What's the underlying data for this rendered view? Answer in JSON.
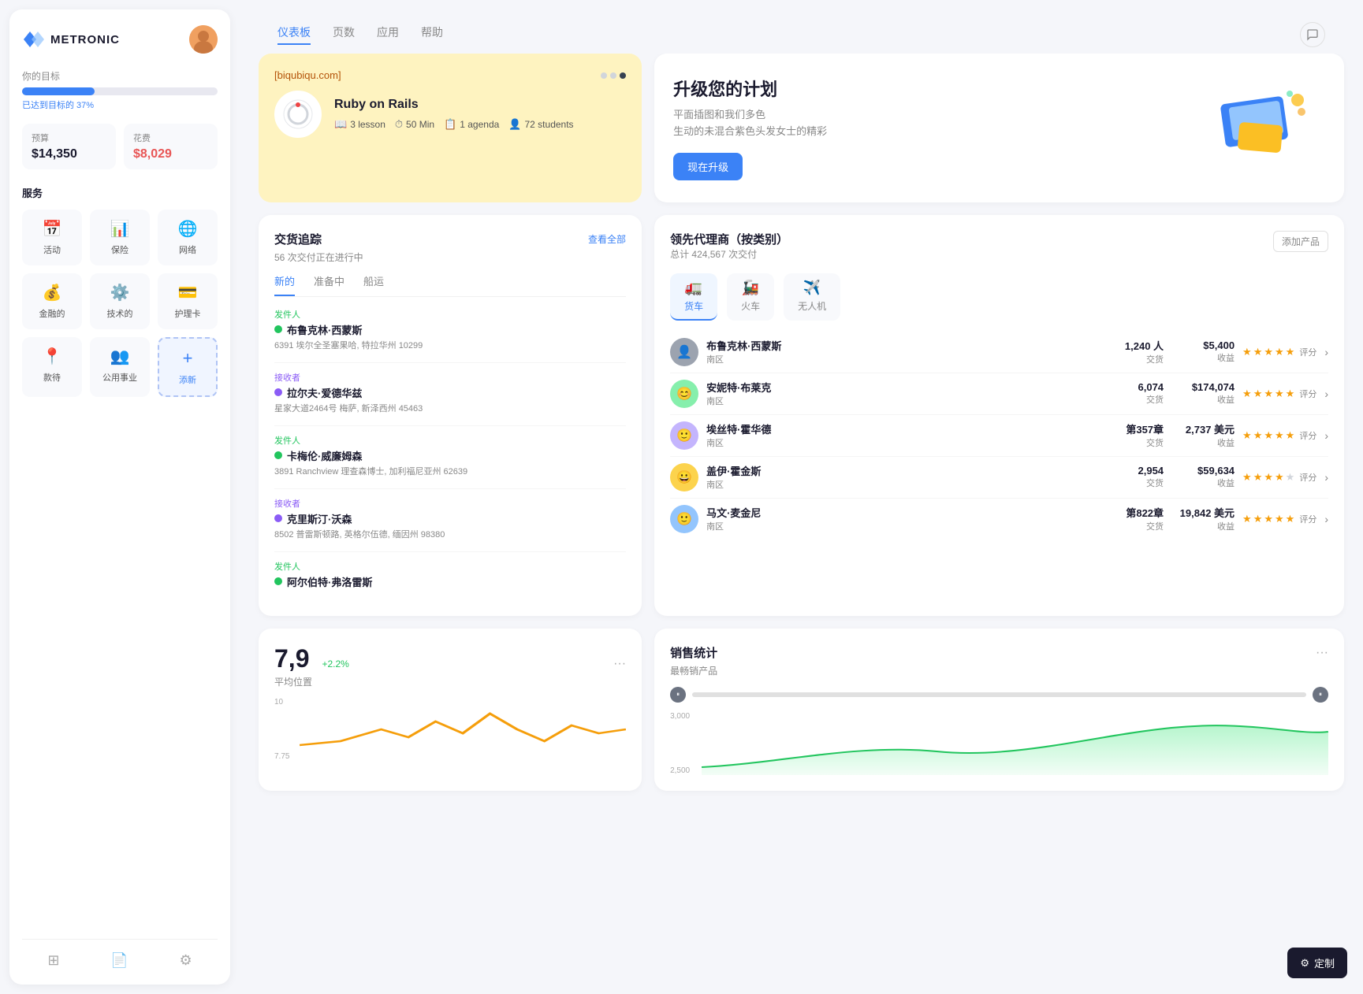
{
  "app": {
    "name": "METRONIC"
  },
  "nav": {
    "tabs": [
      "仪表板",
      "页数",
      "应用",
      "帮助"
    ],
    "active": "仪表板"
  },
  "sidebar": {
    "goal_label": "你的目标",
    "progress_percent": 37,
    "progress_text": "已达到目标的 37%",
    "budget": {
      "label": "预算",
      "value": "$14,350"
    },
    "expense": {
      "label": "花费",
      "value": "$8,029"
    },
    "services_label": "服务",
    "services": [
      {
        "icon": "📅",
        "label": "活动"
      },
      {
        "icon": "📊",
        "label": "保险"
      },
      {
        "icon": "🌐",
        "label": "网络"
      },
      {
        "icon": "💰",
        "label": "金融的"
      },
      {
        "icon": "⚙️",
        "label": "技术的"
      },
      {
        "icon": "💳",
        "label": "护理卡"
      },
      {
        "icon": "📍",
        "label": "款待"
      },
      {
        "icon": "👥",
        "label": "公用事业"
      },
      {
        "icon": "+",
        "label": "添新"
      }
    ],
    "footer_icons": [
      "layers",
      "file",
      "settings"
    ]
  },
  "course_card": {
    "url": "[biqubiqu.com]",
    "title": "Ruby on Rails",
    "meta": [
      {
        "icon": "📖",
        "text": "3 lesson"
      },
      {
        "icon": "⏱",
        "text": "50 Min"
      },
      {
        "icon": "📋",
        "text": "1 agenda"
      },
      {
        "icon": "👤",
        "text": "72 students"
      }
    ]
  },
  "upgrade_card": {
    "title": "升级您的计划",
    "description": "平面插图和我们多色\n生动的未混合紫色头发女士的精彩",
    "button_label": "现在升级"
  },
  "delivery": {
    "title": "交货追踪",
    "subtitle": "56 次交付正在进行中",
    "view_all": "查看全部",
    "tabs": [
      "新的",
      "准备中",
      "船运"
    ],
    "active_tab": "新的",
    "items": [
      {
        "role": "发件人",
        "role_type": "sender",
        "name": "布鲁克林·西蒙斯",
        "address": "6391 埃尔全圣塞果哈, 特拉华州 10299"
      },
      {
        "role": "接收者",
        "role_type": "receiver",
        "name": "拉尔夫·爱德华兹",
        "address": "星家大道2464号 梅萨, 新泽西州 45463"
      },
      {
        "role": "发件人",
        "role_type": "sender",
        "name": "卡梅伦·威廉姆森",
        "address": "3891 Ranchview 理查森博士, 加利福尼亚州 62639"
      },
      {
        "role": "接收者",
        "role_type": "receiver",
        "name": "克里斯汀·沃森",
        "address": "8502 普雷斯顿路, 英格尔伍德, 缅因州 98380"
      },
      {
        "role": "发件人",
        "role_type": "sender",
        "name": "阿尔伯特·弗洛雷斯",
        "address": ""
      }
    ]
  },
  "agents": {
    "title": "领先代理商（按类别）",
    "subtitle": "总计 424,567 次交付",
    "add_button": "添加产品",
    "categories": [
      {
        "icon": "🚛",
        "label": "货车",
        "active": true
      },
      {
        "icon": "🚂",
        "label": "火车"
      },
      {
        "icon": "✈️",
        "label": "无人机"
      }
    ],
    "agents": [
      {
        "name": "布鲁克林·西蒙斯",
        "region": "南区",
        "count": "1,240 人",
        "count_label": "交货",
        "revenue": "$5,400",
        "revenue_label": "收益",
        "rating": 5,
        "rating_label": "评分",
        "color": "#9ca3af"
      },
      {
        "name": "安妮特·布莱克",
        "region": "南区",
        "count": "6,074",
        "count_label": "交货",
        "revenue": "$174,074",
        "revenue_label": "收益",
        "rating": 5,
        "rating_label": "评分",
        "color": "#86efac"
      },
      {
        "name": "埃丝特·霍华德",
        "region": "南区",
        "count": "第357章",
        "count_label": "交货",
        "revenue": "2,737 美元",
        "revenue_label": "收益",
        "rating": 5,
        "rating_label": "评分",
        "color": "#c4b5fd"
      },
      {
        "name": "盖伊·霍金斯",
        "region": "南区",
        "count": "2,954",
        "count_label": "交货",
        "revenue": "$59,634",
        "revenue_label": "收益",
        "rating": 4,
        "rating_label": "评分",
        "color": "#fcd34d"
      },
      {
        "name": "马文·麦金尼",
        "region": "南区",
        "count": "第822章",
        "count_label": "交货",
        "revenue": "19,842 美元",
        "revenue_label": "收益",
        "rating": 5,
        "rating_label": "评分",
        "color": "#93c5fd"
      }
    ]
  },
  "stat_widget": {
    "number": "7,9",
    "growth": "+2.2%",
    "label": "平均位置",
    "y_labels": [
      "10",
      "7.75"
    ]
  },
  "sales": {
    "title": "销售统计",
    "subtitle": "最畅销产品",
    "y_labels": [
      "3,000",
      "2,500"
    ]
  },
  "customize": {
    "label": "定制"
  }
}
